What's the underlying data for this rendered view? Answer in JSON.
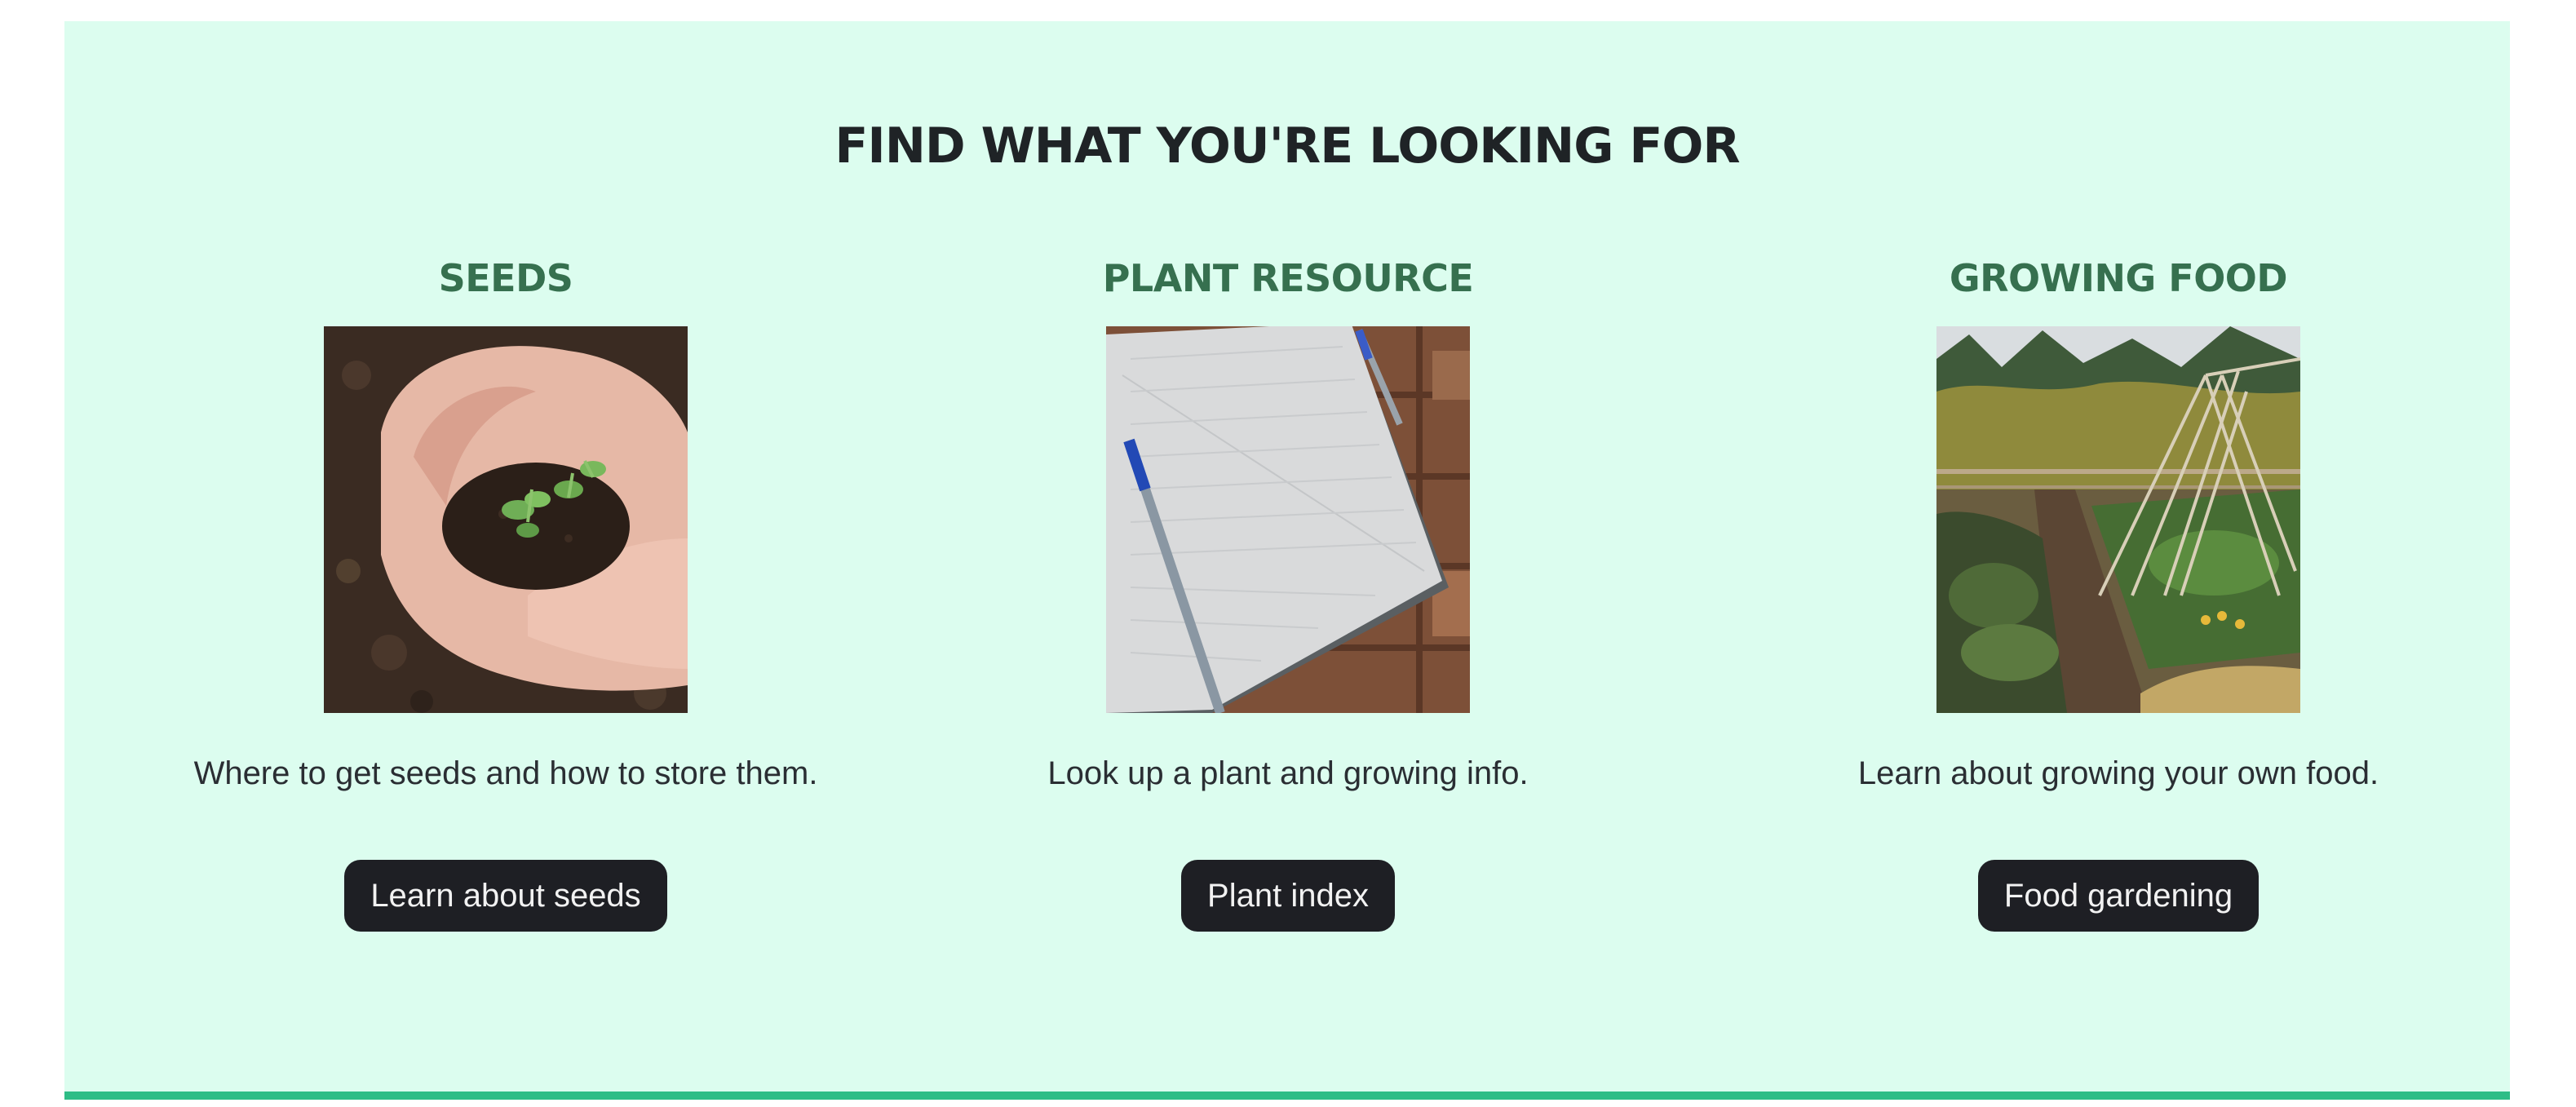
{
  "section": {
    "title": "FIND WHAT YOU'RE LOOKING FOR"
  },
  "cards": [
    {
      "heading": "SEEDS",
      "description": "Where to get seeds and how to store them.",
      "button_label": "Learn about seeds",
      "image": "hands-holding-seedlings-photo"
    },
    {
      "heading": "PLANT RESOURCE",
      "description": "Look up a plant and growing info.",
      "button_label": "Plant index",
      "image": "notebook-and-pen-photo"
    },
    {
      "heading": "GROWING FOOD",
      "description": "Learn about growing your own food.",
      "button_label": "Food gardening",
      "image": "vegetable-garden-trellis-photo"
    }
  ],
  "colors": {
    "panel_background": "#dcfdef",
    "heading_green": "#36704f",
    "button_dark": "#1e1f24",
    "accent_bar": "#2ebd86",
    "title_text": "#1f2326"
  }
}
